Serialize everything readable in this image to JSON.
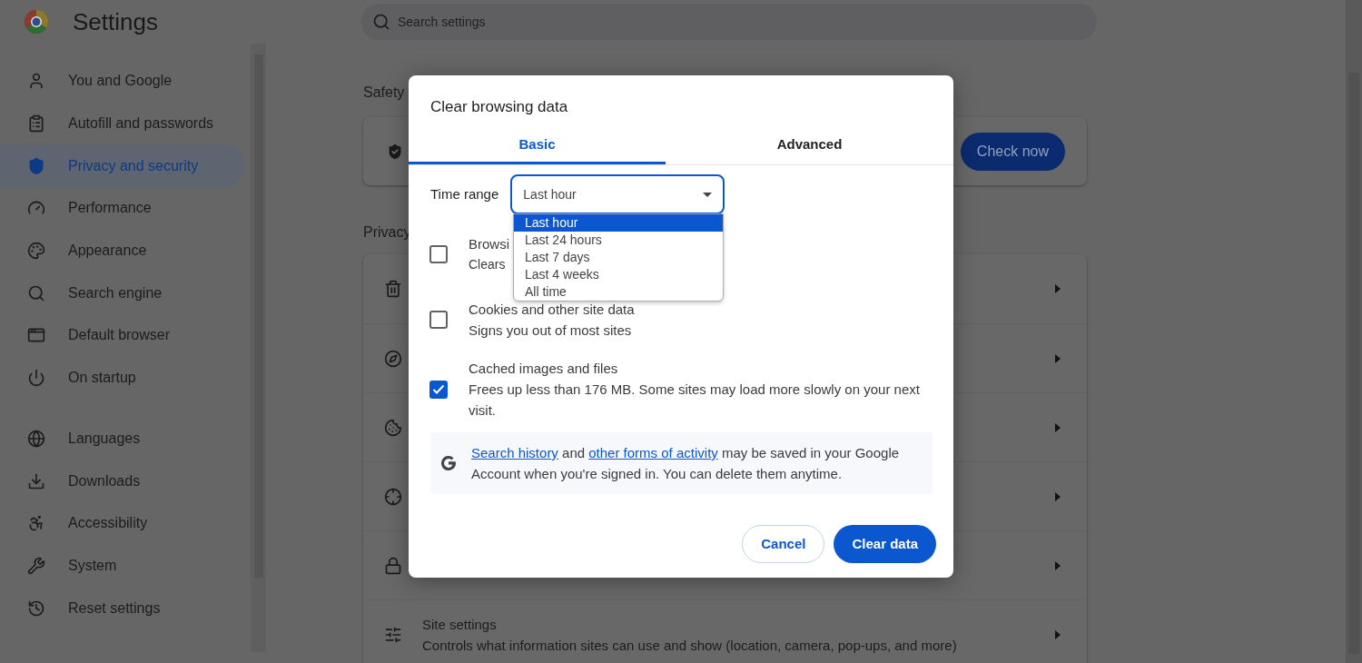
{
  "app": {
    "title": "Settings"
  },
  "search": {
    "placeholder": "Search settings"
  },
  "sidebar": {
    "groups": [
      {
        "items": [
          {
            "label": "You and Google",
            "selected": false
          },
          {
            "label": "Autofill and passwords",
            "selected": false
          },
          {
            "label": "Privacy and security",
            "selected": true
          },
          {
            "label": "Performance",
            "selected": false
          },
          {
            "label": "Appearance",
            "selected": false
          },
          {
            "label": "Search engine",
            "selected": false
          },
          {
            "label": "Default browser",
            "selected": false
          },
          {
            "label": "On startup",
            "selected": false
          }
        ]
      },
      {
        "items": [
          {
            "label": "Languages",
            "selected": false
          },
          {
            "label": "Downloads",
            "selected": false
          },
          {
            "label": "Accessibility",
            "selected": false
          },
          {
            "label": "System",
            "selected": false
          },
          {
            "label": "Reset settings",
            "selected": false
          }
        ]
      }
    ]
  },
  "safety": {
    "heading": "Safety",
    "button": "Check now"
  },
  "privacy": {
    "heading": "Privacy",
    "rows": [
      {
        "kind": "link"
      },
      {
        "kind": "link"
      },
      {
        "kind": "link"
      },
      {
        "kind": "link"
      },
      {
        "kind": "link"
      },
      {
        "kind": "link",
        "title": "Site settings",
        "subtitle": "Controls what information sites can use and show (location, camera, pop-ups, and more)"
      }
    ]
  },
  "dialog": {
    "title": "Clear browsing data",
    "tabs": [
      {
        "label": "Basic",
        "selected": true
      },
      {
        "label": "Advanced",
        "selected": false
      }
    ],
    "time_range": {
      "label": "Time range",
      "value": "Last hour",
      "expanded": true,
      "options": [
        {
          "label": "Last hour",
          "selected": true
        },
        {
          "label": "Last 24 hours",
          "selected": false
        },
        {
          "label": "Last 7 days",
          "selected": false
        },
        {
          "label": "Last 4 weeks",
          "selected": false
        },
        {
          "label": "All time",
          "selected": false
        }
      ]
    },
    "items": [
      {
        "title": "Browsi",
        "subtitle": "Clears",
        "checked": false
      },
      {
        "title": "Cookies and other site data",
        "subtitle": "Signs you out of most sites",
        "checked": false
      },
      {
        "title": "Cached images and files",
        "subtitle": "Frees up less than 176 MB. Some sites may load more slowly on your next visit.",
        "checked": true
      }
    ],
    "notice": {
      "parts": [
        {
          "kind": "link",
          "text": "Search history"
        },
        {
          "kind": "text",
          "text": " and "
        },
        {
          "kind": "link",
          "text": "other forms of activity"
        },
        {
          "kind": "text",
          "text": " may be saved in your Google Account when you're signed in. You can delete them anytime."
        }
      ]
    },
    "buttons": [
      {
        "label": "Cancel",
        "kind": "secondary"
      },
      {
        "label": "Clear data",
        "kind": "primary"
      }
    ]
  }
}
